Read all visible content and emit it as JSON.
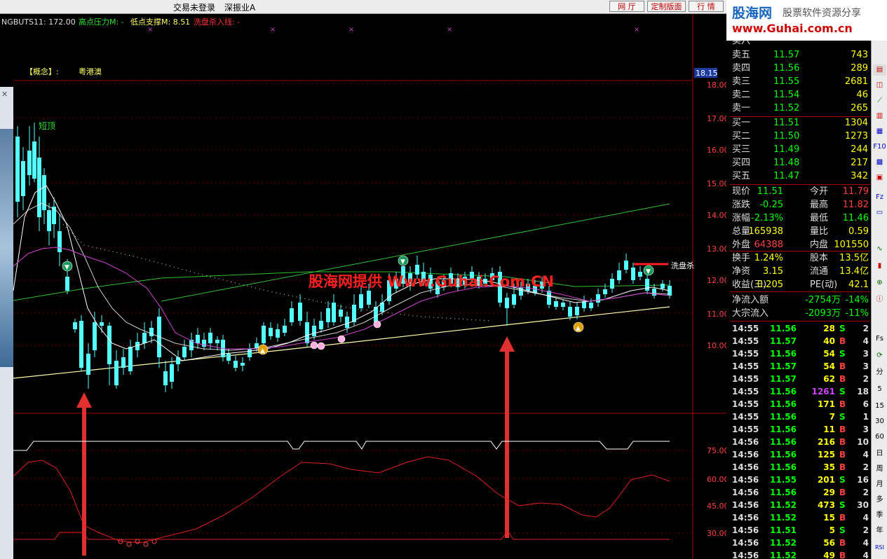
{
  "topbar": {
    "login_status": "交易未登录",
    "stock_name": "深振业A",
    "buttons": [
      "网 厅",
      "定制版面",
      "行 情"
    ]
  },
  "logo": {
    "brand": "股海网",
    "tagline": "股票软件资源分享",
    "url": "www.Guhai.com.cn"
  },
  "indicator_header": {
    "name_value": "NGBUTS11: 172.00",
    "high_pressure": "高点压力M: -",
    "low_support": "低点支撑M: 8.51",
    "washout_line": "洗盘杀入线: -"
  },
  "concept": {
    "label": "【概念】:",
    "value": "粤港澳"
  },
  "price_axis": {
    "current_tag": "18.15",
    "ticks": [
      "18.00",
      "17.00",
      "16.00",
      "15.00",
      "14.00",
      "13.00",
      "12.00",
      "11.00",
      "10.00"
    ]
  },
  "osc_axis": {
    "ticks": [
      "75.00",
      "60.00",
      "45.00",
      "30.00"
    ]
  },
  "chart_annotations": {
    "top_signal": "短顶",
    "washout_label": "洗盘杀",
    "watermark": "股海网提供 Www.Guhai.Com.CN"
  },
  "colors": {
    "up": "#ff4040",
    "down": "#54ffff",
    "ma_white": "#ffffff",
    "ma_magenta": "#d040d0",
    "trend_green": "#30c030",
    "trend_yellow": "#ffffaa",
    "osc_red": "#e02020",
    "grid_red": "#6a0000",
    "watermark": "#ff2020"
  },
  "order_book": {
    "partial_top": "卖六",
    "asks": [
      {
        "label": "卖五",
        "price": "11.57",
        "volume": "743"
      },
      {
        "label": "卖四",
        "price": "11.56",
        "volume": "289"
      },
      {
        "label": "卖三",
        "price": "11.55",
        "volume": "2681"
      },
      {
        "label": "卖二",
        "price": "11.54",
        "volume": "46"
      },
      {
        "label": "卖一",
        "price": "11.52",
        "volume": "265"
      }
    ],
    "bids": [
      {
        "label": "买一",
        "price": "11.51",
        "volume": "1304"
      },
      {
        "label": "买二",
        "price": "11.50",
        "volume": "1273"
      },
      {
        "label": "买三",
        "price": "11.49",
        "volume": "244"
      },
      {
        "label": "买四",
        "price": "11.48",
        "volume": "217"
      },
      {
        "label": "买五",
        "price": "11.47",
        "volume": "342"
      }
    ]
  },
  "stats": [
    {
      "l1": "现价",
      "v1": "11.51",
      "l2": "今开",
      "v2": "11.79",
      "c1": "#00ff00",
      "c2": "#ff4040"
    },
    {
      "l1": "涨跌",
      "v1": "-0.25",
      "l2": "最高",
      "v2": "11.82",
      "c1": "#00ff00",
      "c2": "#ff4040"
    },
    {
      "l1": "涨幅",
      "v1": "-2.13%",
      "l2": "最低",
      "v2": "11.46",
      "c1": "#00ff00",
      "c2": "#00ff00"
    },
    {
      "l1": "总量",
      "v1": "165938",
      "l2": "量比",
      "v2": "0.59",
      "c1": "#ffff00",
      "c2": "#ffff00"
    },
    {
      "l1": "外盘",
      "v1": "64388",
      "l2": "内盘",
      "v2": "101550",
      "c1": "#ff4040",
      "c2": "#ffff00"
    },
    {
      "l1": "换手",
      "v1": "1.24%",
      "l2": "股本",
      "v2": "13.5亿",
      "c1": "#ffff00",
      "c2": "#ffff00"
    },
    {
      "l1": "净资",
      "v1": "3.15",
      "l2": "流通",
      "v2": "13.4亿",
      "c1": "#ffff00",
      "c2": "#ffff00"
    },
    {
      "l1": "收益(三)",
      "v1": "0.205",
      "l2": "PE(动)",
      "v2": "42.1",
      "c1": "#ffff00",
      "c2": "#ffff00"
    }
  ],
  "flows": [
    {
      "label": "净流入额",
      "value": "-2754万",
      "pct": "-14%"
    },
    {
      "label": "大宗流入",
      "value": "-2093万",
      "pct": "-11%"
    }
  ],
  "ticks": [
    {
      "time": "14:55",
      "price": "11.56",
      "vol": "28",
      "side": "S",
      "n": "2"
    },
    {
      "time": "14:55",
      "price": "11.57",
      "vol": "40",
      "side": "B",
      "n": "4"
    },
    {
      "time": "14:55",
      "price": "11.56",
      "vol": "54",
      "side": "S",
      "n": "3"
    },
    {
      "time": "14:55",
      "price": "11.57",
      "vol": "54",
      "side": "B",
      "n": "3"
    },
    {
      "time": "14:55",
      "price": "11.57",
      "vol": "62",
      "side": "B",
      "n": "2"
    },
    {
      "time": "14:55",
      "price": "11.56",
      "vol": "1261",
      "side": "S",
      "n": "18"
    },
    {
      "time": "14:55",
      "price": "11.56",
      "vol": "171",
      "side": "B",
      "n": "6"
    },
    {
      "time": "14:55",
      "price": "11.56",
      "vol": "7",
      "side": "S",
      "n": "1"
    },
    {
      "time": "14:55",
      "price": "11.56",
      "vol": "11",
      "side": "B",
      "n": "3"
    },
    {
      "time": "14:56",
      "price": "11.56",
      "vol": "216",
      "side": "B",
      "n": "10"
    },
    {
      "time": "14:56",
      "price": "11.56",
      "vol": "125",
      "side": "B",
      "n": "4"
    },
    {
      "time": "14:56",
      "price": "11.56",
      "vol": "35",
      "side": "B",
      "n": "2"
    },
    {
      "time": "14:56",
      "price": "11.55",
      "vol": "201",
      "side": "S",
      "n": "16"
    },
    {
      "time": "14:56",
      "price": "11.56",
      "vol": "29",
      "side": "B",
      "n": "2"
    },
    {
      "time": "14:56",
      "price": "11.52",
      "vol": "473",
      "side": "S",
      "n": "30"
    },
    {
      "time": "14:56",
      "price": "11.52",
      "vol": "15",
      "side": "B",
      "n": "4"
    },
    {
      "time": "14:56",
      "price": "11.51",
      "vol": "5",
      "side": "S",
      "n": "2"
    },
    {
      "time": "14:56",
      "price": "11.52",
      "vol": "56",
      "side": "B",
      "n": "4"
    },
    {
      "time": "14:56",
      "price": "11.52",
      "vol": "49",
      "side": "B",
      "n": "4"
    }
  ],
  "right_toolbar": [
    "F10",
    "Fs",
    "分",
    "5",
    "15",
    "30",
    "60",
    "日",
    "周",
    "月",
    "多",
    "季",
    "年",
    "RSI"
  ]
}
